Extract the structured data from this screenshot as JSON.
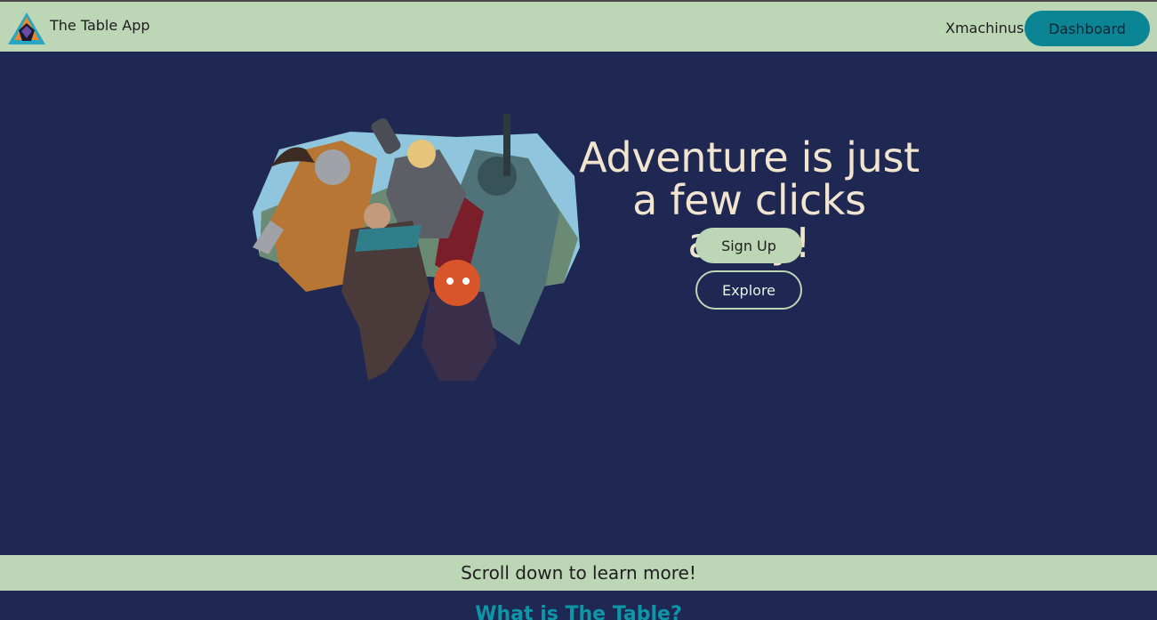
{
  "header": {
    "app_name": "The Table App",
    "logo_icon": "d20-triangle-logo-icon",
    "username": "Xmachinus",
    "dashboard_label": "Dashboard"
  },
  "hero": {
    "headline": "Adventure is just a few clicks away!",
    "signup_label": "Sign Up",
    "explore_label": "Explore",
    "illustration": "fantasy-adventurers-party-illustration"
  },
  "scroll_banner": {
    "text": "Scroll down to learn more!"
  },
  "section": {
    "title": "What is The Table?"
  },
  "colors": {
    "background": "#1f2853",
    "header_bg": "#bdd6b6",
    "accent": "#0b8593",
    "headline": "#f2e5cf",
    "section_title": "#0d96a5"
  }
}
